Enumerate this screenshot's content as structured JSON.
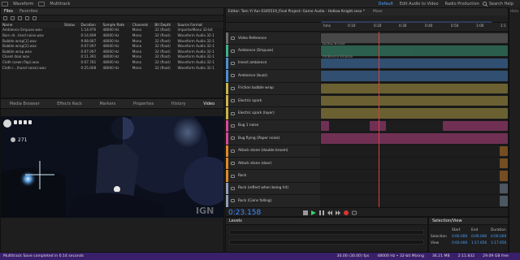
{
  "topbar": {
    "items": [
      "Waveform",
      "Multitrack"
    ],
    "workspaces": [
      "Default",
      "Edit Audio to Video",
      "Radio Production"
    ],
    "search": "Search Help"
  },
  "files_panel": {
    "tabs": [
      "Files",
      "Favorites"
    ],
    "columns": [
      "Name",
      "Status",
      "Duration",
      "Sample Rate",
      "Channels",
      "Bit Depth",
      "Source Format"
    ],
    "rows": [
      {
        "name": "Ambience Empuse.wav",
        "duration": "1:14.976",
        "rate": "48000 Hz",
        "channels": "Mono",
        "depth": "32 (float)",
        "format": "ImporterMono 32-bit"
      },
      {
        "name": "Barn dr...tired noise.wav",
        "duration": "0:14.699",
        "rate": "48000 Hz",
        "channels": "Mono",
        "depth": "32 (float)",
        "format": "Waveform Audio 32-1"
      },
      {
        "name": "Bubble wrap[1].wav",
        "duration": "9:08.687",
        "rate": "48000 Hz",
        "channels": "Mono",
        "depth": "32 (float)",
        "format": "Waveform Audio 32-1"
      },
      {
        "name": "Bubble wrap[2].wav",
        "duration": "0:07.097",
        "rate": "48000 Hz",
        "channels": "Mono",
        "depth": "32 (float)",
        "format": "Waveform Audio 32-1"
      },
      {
        "name": "Bubble wrap.wav",
        "duration": "0:07.097",
        "rate": "48000 Hz",
        "channels": "Mono",
        "depth": "32 (float)",
        "format": "Waveform Audio 32-1"
      },
      {
        "name": "Closet door.wav",
        "duration": "0:11.391",
        "rate": "48000 Hz",
        "channels": "Mono",
        "depth": "32 (float)",
        "format": "Waveform Audio 32-1"
      },
      {
        "name": "Cloth (sewn flap).wav",
        "duration": "0:07.781",
        "rate": "48000 Hz",
        "channels": "Mono",
        "depth": "32 (float)",
        "format": "Waveform Audio 32-1"
      },
      {
        "name": "Cloth r...(hand noise).wav",
        "duration": "0:25.008",
        "rate": "48000 Hz",
        "channels": "Mono",
        "depth": "32 (float)",
        "format": "Waveform Audio 32-1"
      }
    ]
  },
  "media_panel": {
    "tabs": [
      "Media Browser",
      "Effects Rack",
      "Markers",
      "Properties",
      "History",
      "Video"
    ]
  },
  "video": {
    "geo_count": "271",
    "watermark": "IGN"
  },
  "editor": {
    "title": "Editor: Tom Yi Yun 0345519_Final Project: Game Audio - Hollow Knight.sesx *",
    "mixer": "Mixer",
    "ruler": [
      "hms",
      "0:10",
      "0:20",
      "0:30",
      "0:40",
      "0:50",
      "1:00",
      "1:1"
    ],
    "timecode": "0:23.158",
    "tracks": [
      {
        "name": "Video Reference",
        "color": "#6c6c6c",
        "clip": "Hollow Knight"
      },
      {
        "name": "Ambience (Empuse)",
        "color": "#3fb08a",
        "clip": "Ambience Empuse"
      },
      {
        "name": "Insect ambience",
        "color": "#4b8fd6",
        "clip": ""
      },
      {
        "name": "Ambience (buzz)",
        "color": "#4b8fd6",
        "clip": ""
      },
      {
        "name": "Friction bubble wrap",
        "color": "#c9b34b",
        "clip": ""
      },
      {
        "name": "Electric spark",
        "color": "#c9b34b",
        "clip": ""
      },
      {
        "name": "Electric spark (layer)",
        "color": "#c9b34b",
        "clip": ""
      },
      {
        "name": "Bug 1 noise",
        "color": "#d7499a",
        "clip": ""
      },
      {
        "name": "Bug flying (Paper noise)",
        "color": "#d7499a",
        "clip": ""
      },
      {
        "name": "Attack stone (double broom)",
        "color": "#e08a2a",
        "clip": ""
      },
      {
        "name": "Attack stone (door)",
        "color": "#e08a2a",
        "clip": ""
      },
      {
        "name": "Rock",
        "color": "#e08a2a",
        "clip": ""
      },
      {
        "name": "Rock (reflect when being hit)",
        "color": "#8aa0b8",
        "clip": ""
      },
      {
        "name": "Rock (Coins falling)",
        "color": "#8aa0b8",
        "clip": ""
      }
    ]
  },
  "levels": {
    "title": "Levels"
  },
  "selection_view": {
    "title": "Selection/View",
    "headers": [
      "Start",
      "End",
      "Duration"
    ],
    "selection": {
      "label": "Selection",
      "start": "0:00.000",
      "end": "0:00.000",
      "duration": "0:00.000"
    },
    "view": {
      "label": "View",
      "start": "0:00.000",
      "end": "1:17.656",
      "duration": "1:17.656"
    }
  },
  "status": {
    "left": "Multitrack Save completed in 0.14 seconds",
    "fps": "30.00 (30.00) fps",
    "format": "48000 Hz • 32-bit Mixing",
    "mem": "36.21 MB",
    "dur": "2:11.832",
    "free": "29.09 GB free"
  },
  "right_strip": {
    "label": "Histo"
  }
}
